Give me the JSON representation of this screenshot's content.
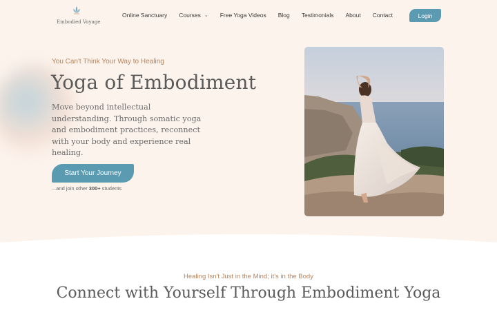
{
  "brand": {
    "name": "Embodied Voyage",
    "logo_icon": "lotus-icon",
    "accent_color": "#5b9bb2",
    "highlight_color": "#b5835c"
  },
  "nav": {
    "items": [
      {
        "label": "Online Sanctuary"
      },
      {
        "label": "Courses",
        "has_dropdown": true
      },
      {
        "label": "Free Yoga Videos"
      },
      {
        "label": "Blog"
      },
      {
        "label": "Testimonials"
      },
      {
        "label": "About"
      },
      {
        "label": "Contact"
      }
    ],
    "login_label": "Login"
  },
  "hero": {
    "eyebrow": "You Can't Think Your Way to Healing",
    "title": "Yoga of Embodiment",
    "copy": "Move beyond intellectual understanding. Through somatic yoga and embodiment practices, reconnect with your body and experience real healing.",
    "cta_label": "Start Your Journey",
    "students_prefix": "...and join other ",
    "students_count": "300+",
    "students_suffix": " students"
  },
  "section": {
    "eyebrow": "Healing Isn't Just in the Mind; it's in the Body",
    "title": "Connect with Yourself Through Embodiment Yoga"
  }
}
